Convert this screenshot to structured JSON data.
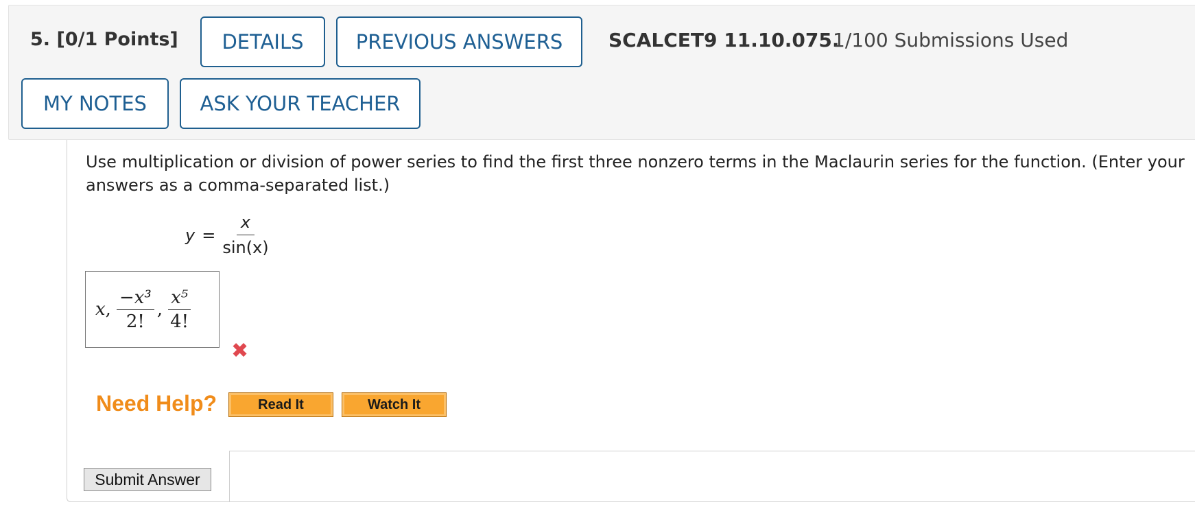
{
  "header": {
    "question_number": "5.",
    "points": "[0/1 Points]",
    "details_label": "DETAILS",
    "previous_answers_label": "PREVIOUS ANSWERS",
    "question_id": "SCALCET9 11.10.075.",
    "submissions": "1/100 Submissions Used",
    "my_notes_label": "MY NOTES",
    "ask_teacher_label": "ASK YOUR TEACHER"
  },
  "question": {
    "prompt": "Use multiplication or division of power series to find the first three nonzero terms in the Maclaurin series for the function. (Enter your answers as a comma-separated list.)",
    "equation": {
      "lhs": "y",
      "equals": "=",
      "numerator": "x",
      "denominator": "sin(x)"
    }
  },
  "answer": {
    "term1": "x",
    "term2_numerator": "−x³",
    "term2_denominator": "2!",
    "term3_numerator": "x⁵",
    "term3_denominator": "4!",
    "status": "incorrect",
    "status_icon": "✖"
  },
  "help": {
    "label": "Need Help?",
    "read_it_label": "Read It",
    "watch_it_label": "Watch It"
  },
  "submit_label": "Submit Answer",
  "colors": {
    "header_bg": "#f5f5f5",
    "button_blue": "#1e5f93",
    "help_orange": "#f08c1a",
    "help_button": "#f9a630",
    "wrong_red": "#e0484f"
  }
}
